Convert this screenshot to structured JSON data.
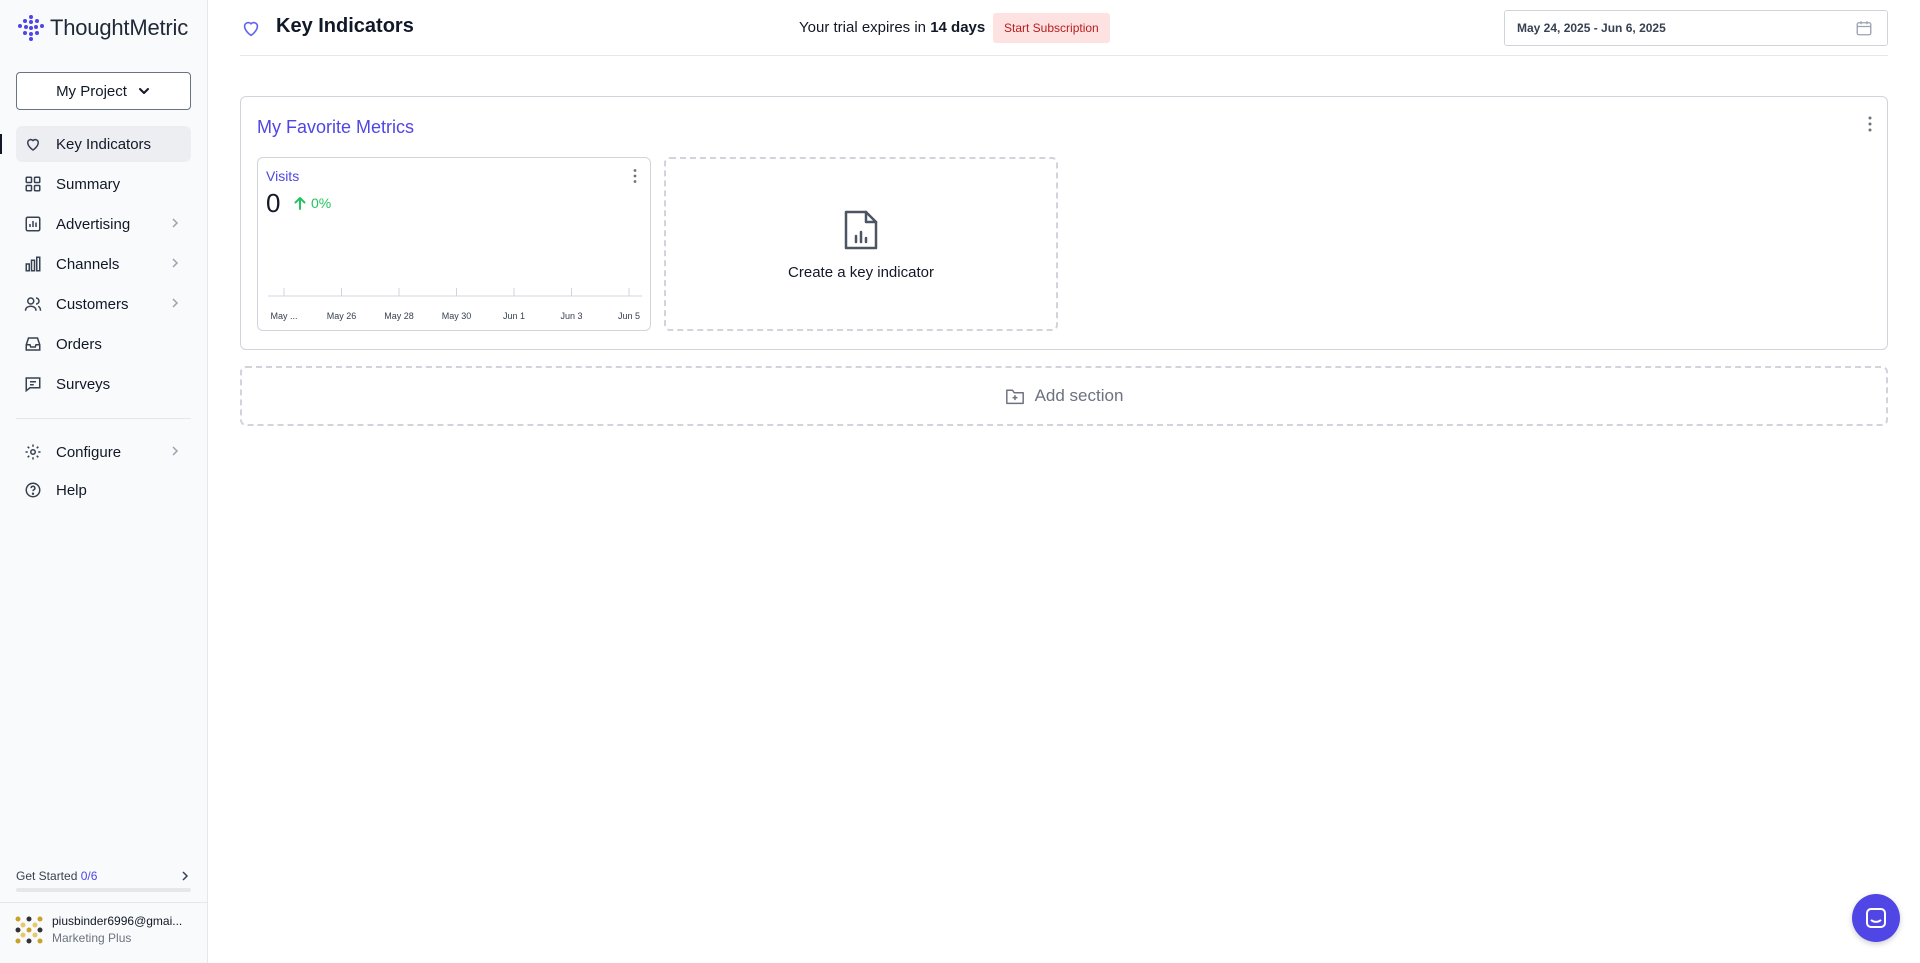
{
  "sidebar": {
    "brand": "ThoughtMetric",
    "project_label": "My Project",
    "nav": [
      {
        "label": "Key Indicators",
        "icon": "heart-icon"
      },
      {
        "label": "Summary",
        "icon": "grid-icon"
      },
      {
        "label": "Advertising",
        "icon": "chart-icon"
      },
      {
        "label": "Channels",
        "icon": "bar-chart-icon"
      },
      {
        "label": "Customers",
        "icon": "users-icon"
      },
      {
        "label": "Orders",
        "icon": "inbox-icon"
      },
      {
        "label": "Surveys",
        "icon": "message-icon"
      }
    ],
    "nav2": [
      {
        "label": "Configure",
        "icon": "gear-icon"
      },
      {
        "label": "Help",
        "icon": "help-icon"
      }
    ],
    "get_started": {
      "label": "Get Started",
      "count": "0/6",
      "progress": 0
    },
    "user": {
      "email": "piusbinder6996@gmai...",
      "plan": "Marketing Plus"
    }
  },
  "header": {
    "title": "Key Indicators",
    "trial_prefix": "Your trial expires in",
    "trial_days": "14 days",
    "subscribe_label": "Start Subscription",
    "date_range": "May 24, 2025 - Jun 6, 2025"
  },
  "section": {
    "title": "My Favorite Metrics",
    "metric_card": {
      "title": "Visits",
      "value": "0",
      "change": "0%"
    },
    "create_label": "Create a key indicator"
  },
  "add_section_label": "Add section",
  "colors": {
    "accent": "#4f46e5",
    "positive": "#22c55e",
    "danger_bg": "#fee2e2",
    "danger_text": "#b91c1c"
  },
  "chart_data": {
    "type": "line",
    "categories": [
      "May ...",
      "May 26",
      "May 28",
      "May 30",
      "Jun 1",
      "Jun 3",
      "Jun 5"
    ],
    "series": [
      {
        "values": [
          0,
          0,
          0,
          0,
          0,
          0,
          0
        ]
      }
    ],
    "title": "Visits",
    "xlabel": "",
    "ylabel": "",
    "grid": false
  }
}
